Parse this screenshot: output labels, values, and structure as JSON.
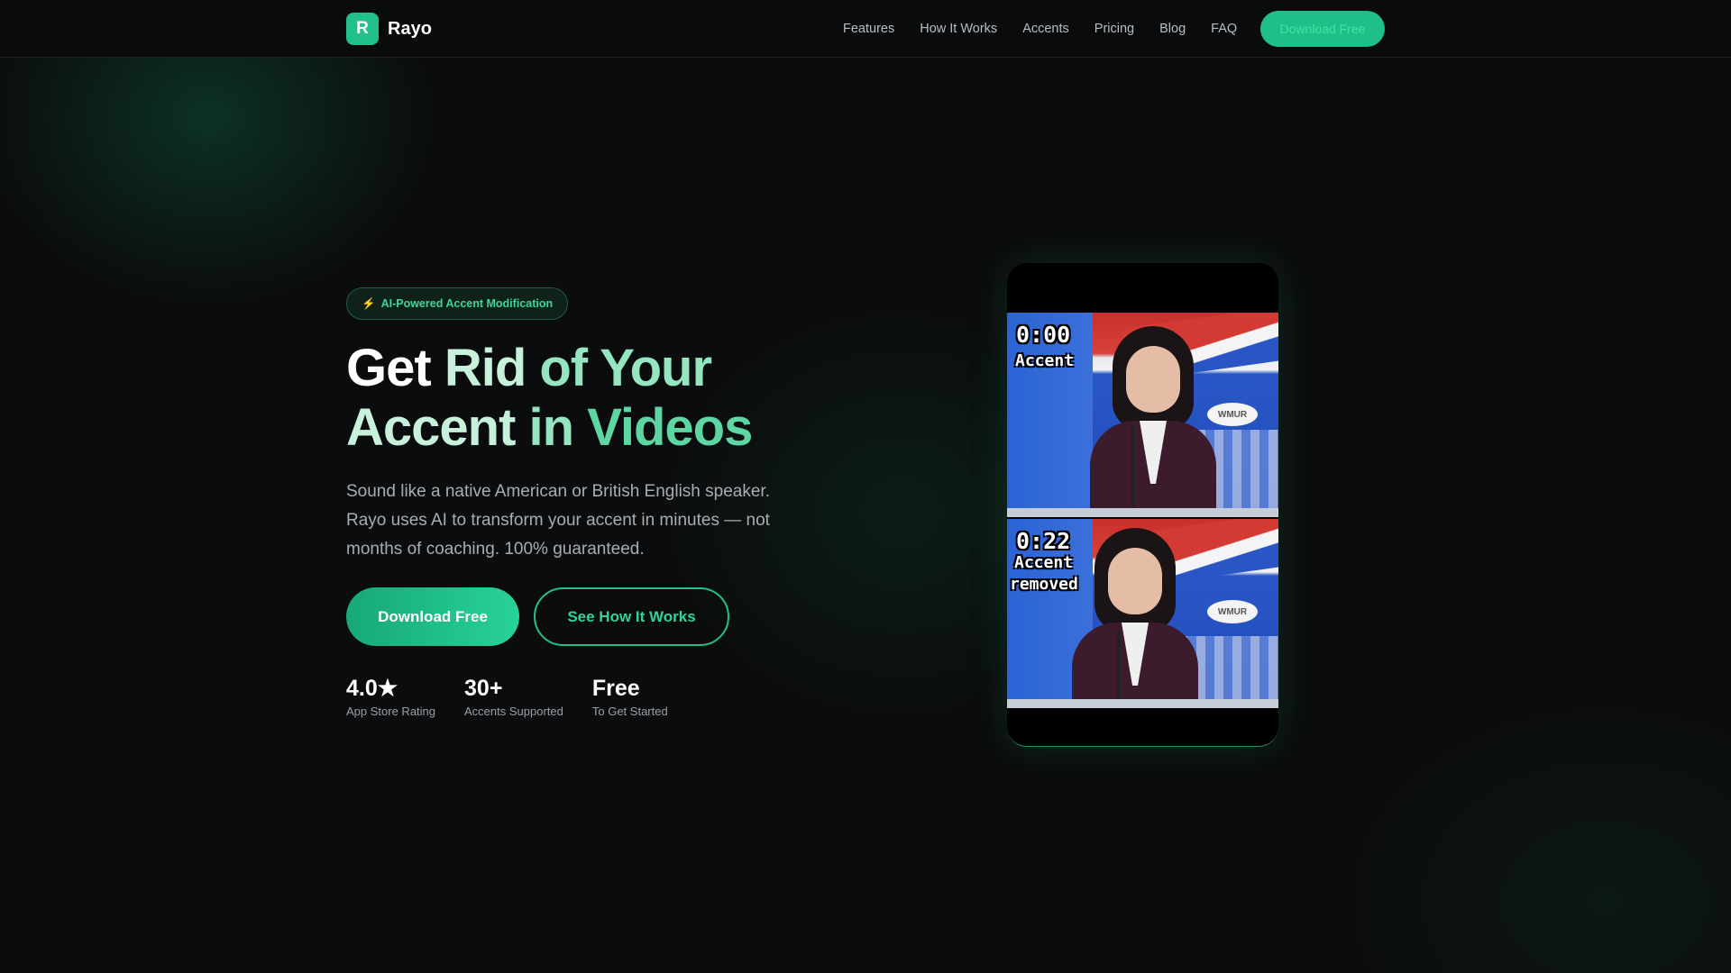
{
  "nav": {
    "logo_letter": "R",
    "brand": "Rayo",
    "links": [
      "Features",
      "How It Works",
      "Accents",
      "Pricing",
      "Blog",
      "FAQ"
    ],
    "cta": "Download Free"
  },
  "hero": {
    "badge_icon": "⚡",
    "badge_text": "AI-Powered Accent Modification",
    "headline_line1": [
      "Get",
      "Rid",
      "of",
      "Your"
    ],
    "headline_line2": [
      "Accent",
      "in",
      "Videos"
    ],
    "subtitle": "Sound like a native American or British English speaker. Rayo uses AI to transform your accent in minutes — not months of coaching. 100% guaranteed.",
    "primary_button": "Download Free",
    "secondary_button": "See How It Works",
    "stats": [
      {
        "value": "4.0★",
        "label": "App Store Rating"
      },
      {
        "value": "30+",
        "label": "Accents Supported"
      },
      {
        "value": "Free",
        "label": "To Get Started"
      }
    ]
  },
  "video": {
    "top": {
      "time": "0:00",
      "caption": [
        "Accent"
      ],
      "logo": "WMUR"
    },
    "bottom": {
      "time": "0:22",
      "caption": [
        "Accent",
        "removed"
      ],
      "logo": "WMUR"
    }
  },
  "colors": {
    "accent": "#22c08a",
    "background": "#0b0c0d"
  }
}
